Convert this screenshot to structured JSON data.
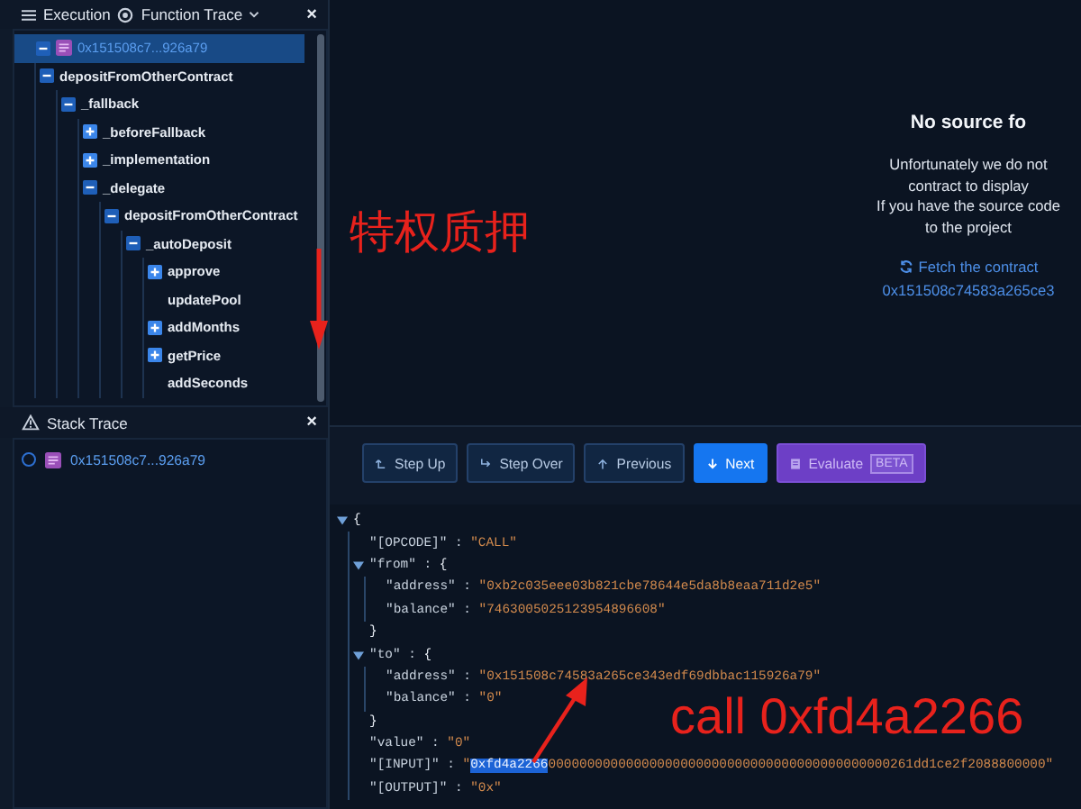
{
  "header": {
    "execution_label": "Execution",
    "trace_label": "Function Trace",
    "close": "×"
  },
  "function_trace": [
    {
      "label": "0x151508c7...926a79",
      "kind": "contract",
      "expanded": true,
      "selected": true,
      "children": [
        {
          "label": "depositFromOtherContract",
          "expanded": true,
          "selected": false,
          "children": [
            {
              "label": "_fallback",
              "expanded": true,
              "selected": false,
              "children": [
                {
                  "label": "_beforeFallback",
                  "expanded": false,
                  "selected": false
                },
                {
                  "label": "_implementation",
                  "expanded": false,
                  "selected": false
                },
                {
                  "label": "_delegate",
                  "expanded": true,
                  "selected": false,
                  "children": [
                    {
                      "label": "depositFromOtherContract",
                      "expanded": true,
                      "selected": false,
                      "children": [
                        {
                          "label": "_autoDeposit",
                          "expanded": true,
                          "selected": false,
                          "children": [
                            {
                              "label": "approve",
                              "expanded": false,
                              "selected": false
                            },
                            {
                              "label": "updatePool",
                              "selected": false
                            },
                            {
                              "label": "addMonths",
                              "expanded": false,
                              "selected": false
                            },
                            {
                              "label": "getPrice",
                              "expanded": false,
                              "selected": false
                            },
                            {
                              "label": "addSeconds",
                              "selected": false
                            }
                          ]
                        }
                      ]
                    }
                  ]
                }
              ]
            }
          ]
        }
      ]
    }
  ],
  "stack_trace": {
    "title": "Stack Trace",
    "close": "×",
    "items": [
      {
        "label": "0x151508c7...926a79",
        "selected": false
      }
    ]
  },
  "no_source": {
    "title": "No source fo",
    "lines": [
      "Unfortunately we do not",
      "contract to display",
      "If you have the source code",
      "to the project"
    ],
    "fetch_link": "Fetch the contract",
    "address": "0x151508c74583a265ce3"
  },
  "toolbar": [
    {
      "label": "Step Up",
      "kind": "default"
    },
    {
      "label": "Step Over",
      "kind": "default"
    },
    {
      "label": "Previous",
      "kind": "default"
    },
    {
      "label": "Next",
      "kind": "primary"
    },
    {
      "label": "Evaluate",
      "kind": "evaluate",
      "badge": "BETA"
    }
  ],
  "json_view": {
    "open": "{",
    "expanded": true,
    "children": [
      {
        "key": "\"[OPCODE]\"",
        "sep": " : ",
        "value": "\"CALL\""
      },
      {
        "key": "\"from\"",
        "sep": " : ",
        "open": "{",
        "expanded": true,
        "close": "}",
        "children": [
          {
            "key": "\"address\"",
            "sep": " : ",
            "value": "\"0xb2c035eee03b821cbe78644e5da8b8eaa711d2e5\""
          },
          {
            "key": "\"balance\"",
            "sep": " : ",
            "value": "\"7463005025123954896608\""
          }
        ]
      },
      {
        "key": "\"to\"",
        "sep": " : ",
        "open": "{",
        "expanded": true,
        "close": "}",
        "children": [
          {
            "key": "\"address\"",
            "sep": " : ",
            "value": "\"0x151508c74583a265ce343edf69dbbac115926a79\""
          },
          {
            "key": "\"balance\"",
            "sep": " : ",
            "value": "\"0\""
          }
        ]
      },
      {
        "key": "\"value\"",
        "sep": " : ",
        "value": "\"0\""
      },
      {
        "key": "\"[INPUT]\"",
        "sep": " : ",
        "value_prefix": "\"",
        "value_highlight": "0xfd4a2266",
        "value": "00000000000000000000000000000000000000000000261dd1ce2f2088800000\""
      },
      {
        "key": "\"[OUTPUT]\"",
        "sep": " : ",
        "value": "\"0x\""
      }
    ]
  },
  "annotations": [
    {
      "text": "特权质押",
      "kind": "label"
    },
    {
      "text": "call 0xfd4a2266",
      "kind": "label"
    }
  ]
}
